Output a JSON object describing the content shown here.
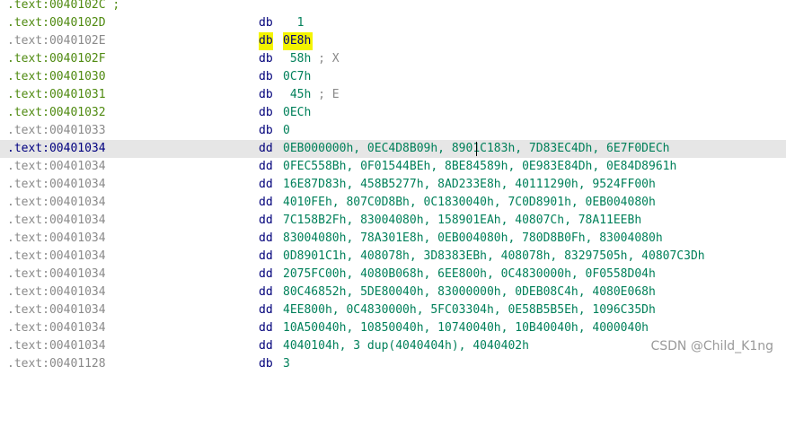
{
  "section": ".text",
  "colors": {
    "address_defined": "#4f8a10",
    "address_continuation": "#8a8a8a",
    "address_current": "#000080",
    "operand": "#00805a",
    "mnemonic": "#00007a",
    "highlight": "#f4f400",
    "current_line_bg": "#e6e6e6"
  },
  "rows": [
    {
      "address": "0040102C",
      "mnemonic": "",
      "operands": "",
      "comment": ""
    },
    {
      "address": "0040102D",
      "mnemonic": "db",
      "operands": "  1",
      "comment": ""
    },
    {
      "address": "0040102E",
      "mnemonic": "db",
      "operands": "0E8h",
      "comment": ""
    },
    {
      "address": "0040102F",
      "mnemonic": "db",
      "operands": " 58h",
      "comment": "; X"
    },
    {
      "address": "00401030",
      "mnemonic": "db",
      "operands": "0C7h",
      "comment": ""
    },
    {
      "address": "00401031",
      "mnemonic": "db",
      "operands": " 45h",
      "comment": "; E"
    },
    {
      "address": "00401032",
      "mnemonic": "db",
      "operands": "0ECh",
      "comment": ""
    },
    {
      "address": "00401033",
      "mnemonic": "db",
      "operands": "0",
      "comment": ""
    },
    {
      "address": "00401034",
      "mnemonic": "dd",
      "operands": "0EB000000h, 0EC4D8B09h, 8901C183h, 7D83EC4Dh, 6E7F0DECh",
      "comment": ""
    },
    {
      "address": "00401034",
      "mnemonic": "dd",
      "operands": "0FEC558Bh, 0F01544BEh, 8BE84589h, 0E983E84Dh, 0E84D8961h",
      "comment": ""
    },
    {
      "address": "00401034",
      "mnemonic": "dd",
      "operands": "16E87D83h, 458B5277h, 8AD233E8h, 40111290h, 9524FF00h",
      "comment": ""
    },
    {
      "address": "00401034",
      "mnemonic": "dd",
      "operands": "4010FEh, 807C0D8Bh, 0C1830040h, 7C0D8901h, 0EB004080h",
      "comment": ""
    },
    {
      "address": "00401034",
      "mnemonic": "dd",
      "operands": "7C158B2Fh, 83004080h, 158901EAh, 40807Ch, 78A11EEBh",
      "comment": ""
    },
    {
      "address": "00401034",
      "mnemonic": "dd",
      "operands": "83004080h, 78A301E8h, 0EB004080h, 780D8B0Fh, 83004080h",
      "comment": ""
    },
    {
      "address": "00401034",
      "mnemonic": "dd",
      "operands": "0D8901C1h, 408078h, 3D8383EBh, 408078h, 83297505h, 40807C3Dh",
      "comment": ""
    },
    {
      "address": "00401034",
      "mnemonic": "dd",
      "operands": "2075FC00h, 4080B068h, 6EE800h, 0C4830000h, 0F0558D04h",
      "comment": ""
    },
    {
      "address": "00401034",
      "mnemonic": "dd",
      "operands": "80C46852h, 5DE80040h, 83000000h, 0DEB08C4h, 4080E068h",
      "comment": ""
    },
    {
      "address": "00401034",
      "mnemonic": "dd",
      "operands": "4EE800h, 0C4830000h, 5FC03304h, 0E58B5B5Eh, 1096C35Dh",
      "comment": ""
    },
    {
      "address": "00401034",
      "mnemonic": "dd",
      "operands": "10A50040h, 10850040h, 10740040h, 10B40040h, 4000040h",
      "comment": ""
    },
    {
      "address": "00401034",
      "mnemonic": "dd",
      "operands": "4040104h, 3 dup(4040404h), 4040402h",
      "comment": ""
    },
    {
      "address": "00401128",
      "mnemonic": "db",
      "operands": "3",
      "comment": ""
    }
  ],
  "watermark": "CSDN @Child_K1ng"
}
